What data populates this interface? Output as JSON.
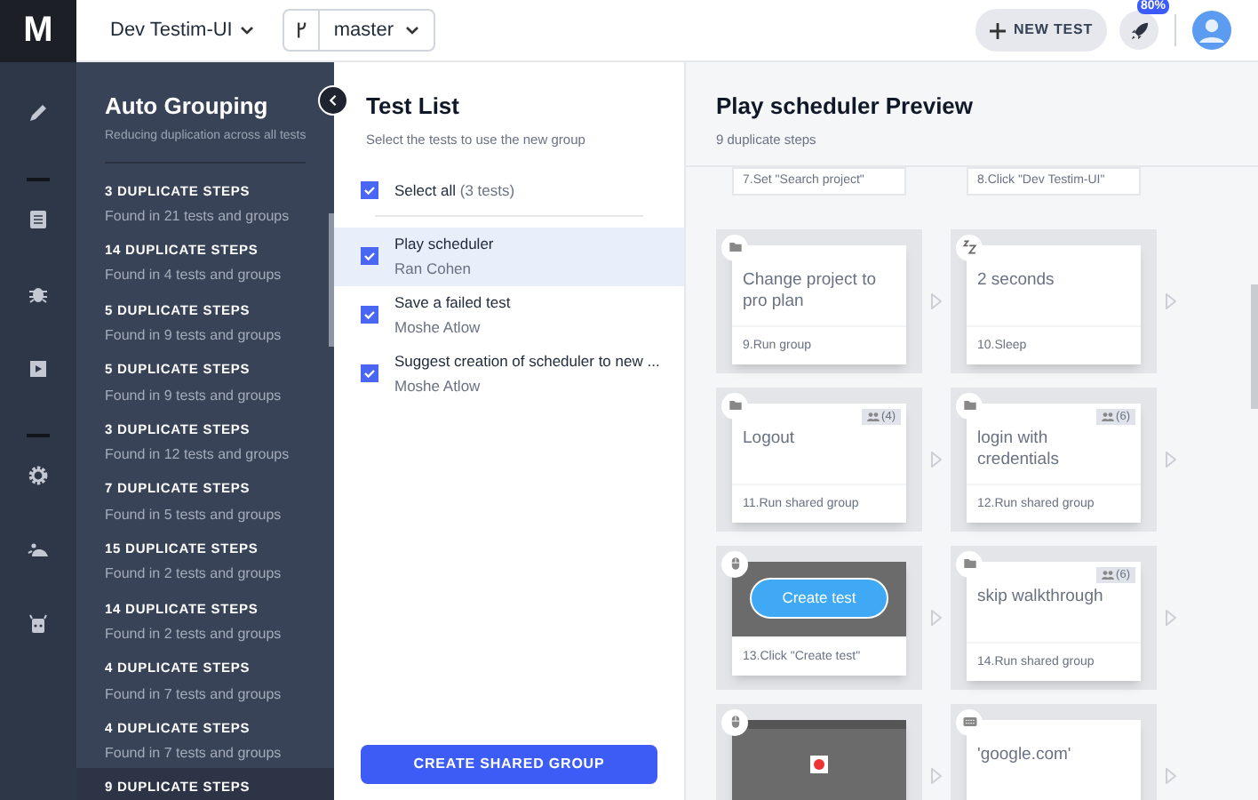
{
  "logo": "M",
  "topbar": {
    "project": "Dev Testim-UI",
    "branch": "master",
    "new_test": "NEW TEST",
    "usage_badge": "80%"
  },
  "rail": {
    "items": [
      {
        "kind": "pencil",
        "selected": false
      },
      {
        "kind": "divider"
      },
      {
        "kind": "list",
        "selected": false
      },
      {
        "kind": "bug",
        "selected": false
      },
      {
        "kind": "play",
        "selected": false
      },
      {
        "kind": "divider"
      },
      {
        "kind": "gear",
        "selected": false
      },
      {
        "kind": "cloud",
        "selected": false
      },
      {
        "kind": "robot",
        "selected": false
      }
    ]
  },
  "grouping": {
    "title": "Auto Grouping",
    "subtitle": "Reducing duplication across all tests",
    "items": [
      {
        "title": "3 DUPLICATE STEPS",
        "subtitle": "Found in 21 tests and groups",
        "selected": false
      },
      {
        "title": "14 DUPLICATE STEPS",
        "subtitle": "Found in 4 tests and groups",
        "selected": false
      },
      {
        "title": "5 DUPLICATE STEPS",
        "subtitle": "Found in 9 tests and groups",
        "selected": false
      },
      {
        "title": "5 DUPLICATE STEPS",
        "subtitle": "Found in 9 tests and groups",
        "selected": false
      },
      {
        "title": "3 DUPLICATE STEPS",
        "subtitle": "Found in 12 tests and groups",
        "selected": false
      },
      {
        "title": "7 DUPLICATE STEPS",
        "subtitle": "Found in 5 tests and groups",
        "selected": false
      },
      {
        "title": "15 DUPLICATE STEPS",
        "subtitle": "Found in 2 tests and groups",
        "selected": false
      },
      {
        "title": "14 DUPLICATE STEPS",
        "subtitle": "Found in 2 tests and groups",
        "selected": false
      },
      {
        "title": "4 DUPLICATE STEPS",
        "subtitle": "Found in 7 tests and groups",
        "selected": false
      },
      {
        "title": "4 DUPLICATE STEPS",
        "subtitle": "Found in 7 tests and groups",
        "selected": false
      },
      {
        "title": "9 DUPLICATE STEPS",
        "selected": true
      }
    ]
  },
  "test_list": {
    "title": "Test List",
    "subtitle": "Select the tests to use the new group",
    "select_all": {
      "label": "Select all",
      "count": "(3 tests)",
      "checked": true
    },
    "tests": [
      {
        "name": "Play scheduler",
        "author": "Ran Cohen",
        "checked": true,
        "selected": true
      },
      {
        "name": "Save a failed test",
        "author": "Moshe Atlow",
        "checked": true,
        "selected": false
      },
      {
        "name": "Suggest creation of scheduler to new ...",
        "author": "Moshe Atlow",
        "checked": true,
        "selected": false
      }
    ],
    "button": "CREATE SHARED GROUP"
  },
  "preview": {
    "title": "Play scheduler Preview",
    "subtitle": "9 duplicate steps",
    "top_row": [
      "7.Set \"Search project\"",
      "8.Click \"Dev Testim-UI\""
    ],
    "rows": [
      [
        {
          "kind": "group",
          "text": "Change project to pro plan",
          "footer": "9.Run group"
        },
        {
          "kind": "sleep",
          "text": "2 seconds",
          "footer": "10.Sleep"
        }
      ],
      [
        {
          "kind": "group",
          "text": "Logout",
          "footer": "11.Run shared group",
          "badge": "(4)"
        },
        {
          "kind": "group",
          "text": "login with credentials",
          "footer": "12.Run shared group",
          "badge": "(6)"
        }
      ],
      [
        {
          "kind": "click",
          "text": "Create test",
          "footer": "13.Click \"Create test\""
        },
        {
          "kind": "group",
          "text": "skip walkthrough",
          "footer": "14.Run shared group",
          "badge": "(6)"
        }
      ],
      [
        {
          "kind": "click"
        },
        {
          "kind": "set",
          "text": "'google.com'"
        }
      ]
    ]
  }
}
